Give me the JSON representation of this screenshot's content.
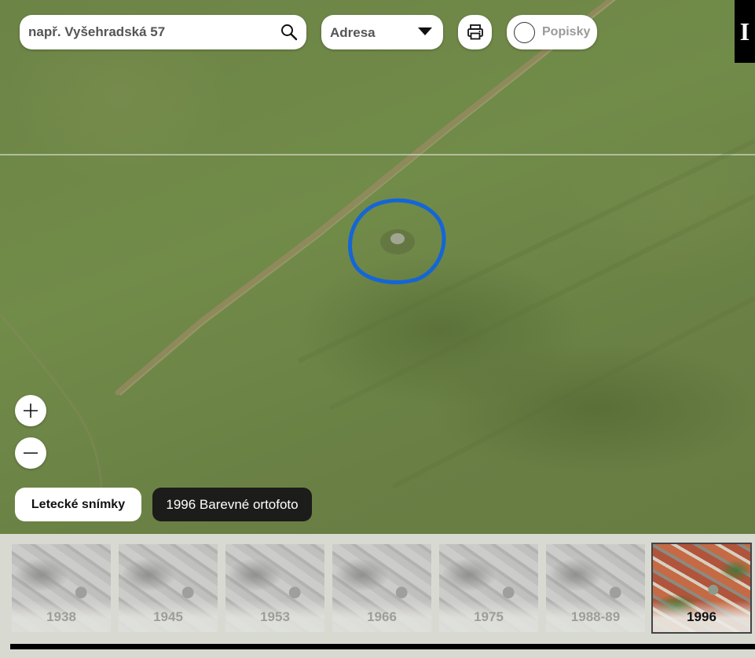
{
  "search": {
    "placeholder": "např. Vyšehradská 57",
    "value": ""
  },
  "search_type": {
    "selected": "Adresa"
  },
  "labels_toggle": {
    "label": "Popisky",
    "checked": false
  },
  "info_tab": {
    "label": "I"
  },
  "layers": {
    "button_label": "Letecké snímky",
    "current_layer": "1996 Barevné ortofoto"
  },
  "timeline": {
    "items": [
      {
        "year": "1938",
        "active": false
      },
      {
        "year": "1945",
        "active": false
      },
      {
        "year": "1953",
        "active": false
      },
      {
        "year": "1966",
        "active": false
      },
      {
        "year": "1975",
        "active": false
      },
      {
        "year": "1988-89",
        "active": false
      },
      {
        "year": "1996",
        "active": true
      }
    ]
  },
  "colors": {
    "highlight_ring": "#1466d6",
    "current_layer_bg": "#1c1c1a",
    "grass": "#6e8847"
  }
}
